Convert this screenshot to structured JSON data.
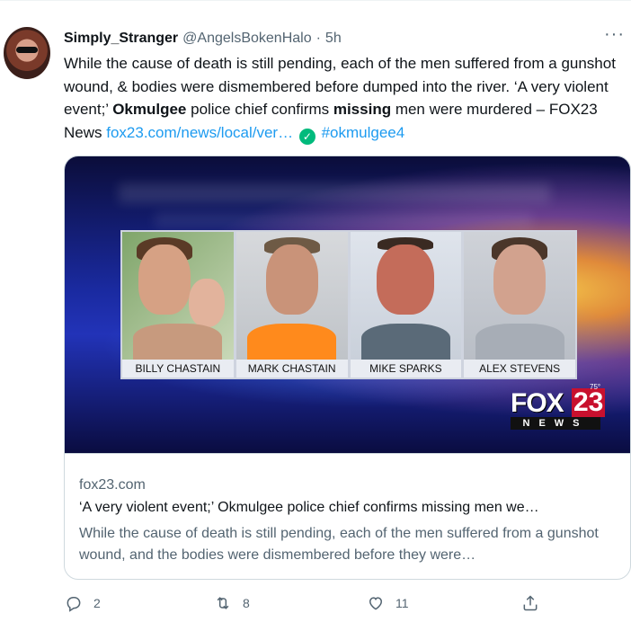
{
  "tweet": {
    "author_name": "Simply_Stranger",
    "author_handle": "@AngelsBokenHalo",
    "separator": "·",
    "time": "5h",
    "more_label": "···",
    "text": {
      "part1": "While the cause of death is still pending, each of the men suffered from a gunshot wound, & bodies were dismembered before dumped into the river. ‘A very violent event;’ ",
      "bold1": "Okmulgee",
      "part2": " police chief confirms ",
      "bold2": "missing",
      "part3": " men were murdered – FOX23 News ",
      "link": "fox23.com/news/local/ver…",
      "check": "✓",
      "hashtag": "#okmulgee4"
    }
  },
  "media": {
    "photo_labels": [
      "BILLY CHASTAIN",
      "MARK CHASTAIN",
      "MIKE SPARKS",
      "ALEX STEVENS"
    ],
    "logo_fox": "FOX",
    "logo_number": "23",
    "logo_news": "NEWS",
    "logo_temp": "75°"
  },
  "card": {
    "domain": "fox23.com",
    "title": "‘A very violent event;’ Okmulgee police chief confirms missing men we…",
    "description": "While the cause of death is still pending, each of the men suffered from a gunshot wound, and the bodies were dismembered before they were…"
  },
  "actions": {
    "reply_count": "2",
    "retweet_count": "8",
    "like_count": "11"
  },
  "colors": {
    "link": "#1d9bf0",
    "secondary_text": "#536471",
    "verified": "#00ba7c"
  }
}
